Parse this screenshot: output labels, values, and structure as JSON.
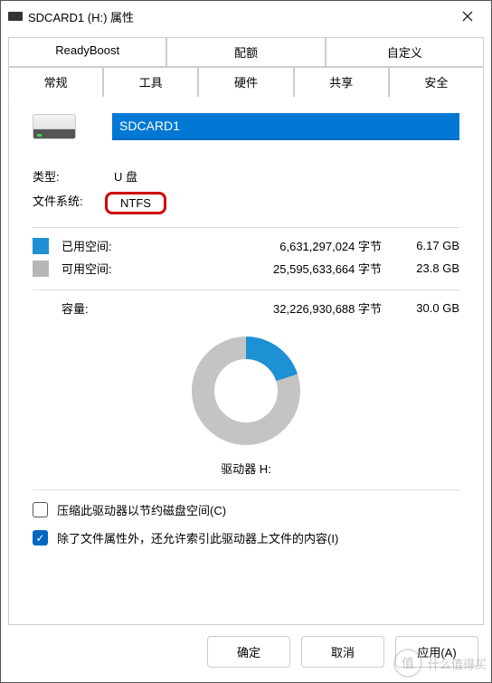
{
  "window": {
    "title": "SDCARD1 (H:) 属性"
  },
  "tabs": {
    "row1": [
      "ReadyBoost",
      "配额",
      "自定义"
    ],
    "row2": [
      "常规",
      "工具",
      "硬件",
      "共享",
      "安全"
    ],
    "active": "常规"
  },
  "drive": {
    "name_value": "SDCARD1",
    "type_label": "类型:",
    "type_value": "U 盘",
    "fs_label": "文件系统:",
    "fs_value": "NTFS"
  },
  "space": {
    "used_label": "已用空间:",
    "used_bytes": "6,631,297,024 字节",
    "used_size": "6.17 GB",
    "free_label": "可用空间:",
    "free_bytes": "25,595,633,664 字节",
    "free_size": "23.8 GB",
    "cap_label": "容量:",
    "cap_bytes": "32,226,930,688 字节",
    "cap_size": "30.0 GB"
  },
  "drive_text": "驱动器 H:",
  "checks": {
    "compress": "压缩此驱动器以节约磁盘空间(C)",
    "index": "除了文件属性外，还允许索引此驱动器上文件的内容(I)"
  },
  "buttons": {
    "ok": "确定",
    "cancel": "取消",
    "apply": "应用(A)"
  },
  "watermark": {
    "icon": "值",
    "text": "什么值得买"
  }
}
